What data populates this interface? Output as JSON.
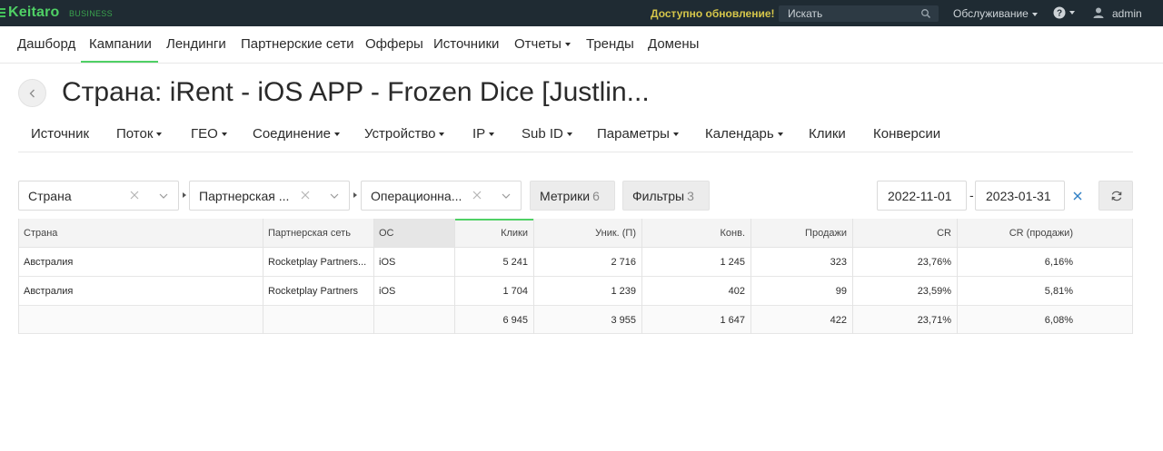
{
  "topbar": {
    "logo": "Keitaro",
    "edition": "BUSINESS",
    "update_notice": "Доступно обновление!",
    "search_placeholder": "Искать",
    "service_menu": "Обслуживание",
    "user": "admin",
    "colors": {
      "bg": "#1f2b33",
      "brand": "#4fd065",
      "notice": "#d6c64a"
    }
  },
  "nav": {
    "items": [
      {
        "label": "Дашборд"
      },
      {
        "label": "Кампании",
        "active": true
      },
      {
        "label": "Лендинги"
      },
      {
        "label": "Партнерские сети"
      },
      {
        "label": "Офферы"
      },
      {
        "label": "Источники"
      },
      {
        "label": "Отчеты",
        "dropdown": true
      },
      {
        "label": "Тренды"
      },
      {
        "label": "Домены"
      }
    ]
  },
  "page": {
    "title": "Страна: iRent - iOS APP - Frozen Dice [Justlin..."
  },
  "report_tabs": [
    {
      "label": "Источник"
    },
    {
      "label": "Поток",
      "dropdown": true
    },
    {
      "label": "ГЕО",
      "dropdown": true
    },
    {
      "label": "Соединение",
      "dropdown": true
    },
    {
      "label": "Устройство",
      "dropdown": true
    },
    {
      "label": "IP",
      "dropdown": true
    },
    {
      "label": "Sub ID",
      "dropdown": true
    },
    {
      "label": "Параметры",
      "dropdown": true
    },
    {
      "label": "Календарь",
      "dropdown": true
    },
    {
      "label": "Клики"
    },
    {
      "label": "Конверсии"
    }
  ],
  "filters": {
    "groupings": [
      {
        "value": "Страна"
      },
      {
        "value": "Партнерская ..."
      },
      {
        "value": "Операционна..."
      }
    ],
    "metrics": {
      "label": "Метрики",
      "count": "6"
    },
    "filters": {
      "label": "Фильтры",
      "count": "3"
    },
    "date_from": "2022-11-01",
    "date_separator": "-",
    "date_to": "2023-01-31"
  },
  "table": {
    "columns": [
      "Страна",
      "Партнерская сеть",
      "ОС",
      "Клики",
      "Уник. (П)",
      "Конв.",
      "Продажи",
      "CR",
      "CR (продажи)"
    ],
    "rows": [
      [
        "Австралия",
        "Rocketplay Partners...",
        "iOS",
        "5 241",
        "2 716",
        "1 245",
        "323",
        "23,76%",
        "6,16%"
      ],
      [
        "Австралия",
        "Rocketplay Partners",
        "iOS",
        "1 704",
        "1 239",
        "402",
        "99",
        "23,59%",
        "5,81%"
      ]
    ],
    "totals": [
      "",
      "",
      "",
      "6 945",
      "3 955",
      "1 647",
      "422",
      "23,71%",
      "6,08%"
    ]
  }
}
